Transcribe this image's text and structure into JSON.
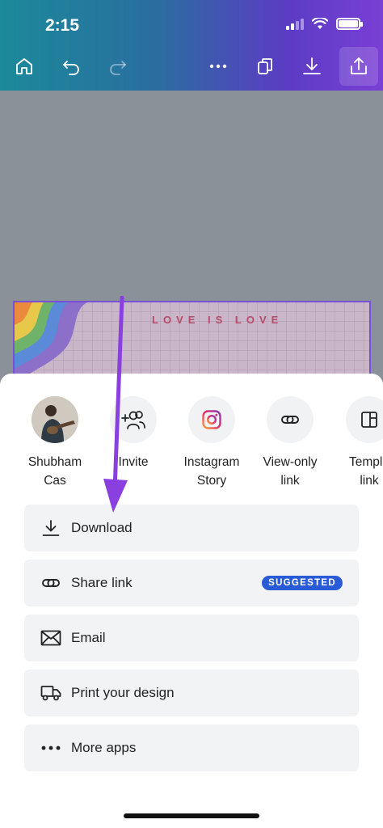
{
  "status_bar": {
    "time": "2:15"
  },
  "toolbar": {
    "icons": [
      "home-icon",
      "undo-icon",
      "redo-icon",
      "more-icon",
      "pages-icon",
      "download-icon",
      "share-icon"
    ]
  },
  "design": {
    "title": "LOVE IS LOVE"
  },
  "share_targets": [
    {
      "line1": "Shubham",
      "line2": "Cas",
      "icon": "avatar"
    },
    {
      "line1": "Invite",
      "line2": "",
      "icon": "invite-people-icon"
    },
    {
      "line1": "Instagram",
      "line2": "Story",
      "icon": "instagram-icon"
    },
    {
      "line1": "View-only",
      "line2": "link",
      "icon": "link-icon"
    },
    {
      "line1": "Templa",
      "line2": "link",
      "icon": "template-icon"
    }
  ],
  "actions": [
    {
      "label": "Download",
      "icon": "download-icon"
    },
    {
      "label": "Share link",
      "icon": "link-icon",
      "badge": "SUGGESTED"
    },
    {
      "label": "Email",
      "icon": "envelope-icon"
    },
    {
      "label": "Print your design",
      "icon": "truck-icon"
    },
    {
      "label": "More apps",
      "icon": "dots-icon"
    }
  ],
  "colors": {
    "header_start": "#1b8a9a",
    "header_end": "#7a3fd6",
    "badge": "#2a5bd7",
    "arrow": "#8a3fe0",
    "instagram": "#e1306c"
  }
}
